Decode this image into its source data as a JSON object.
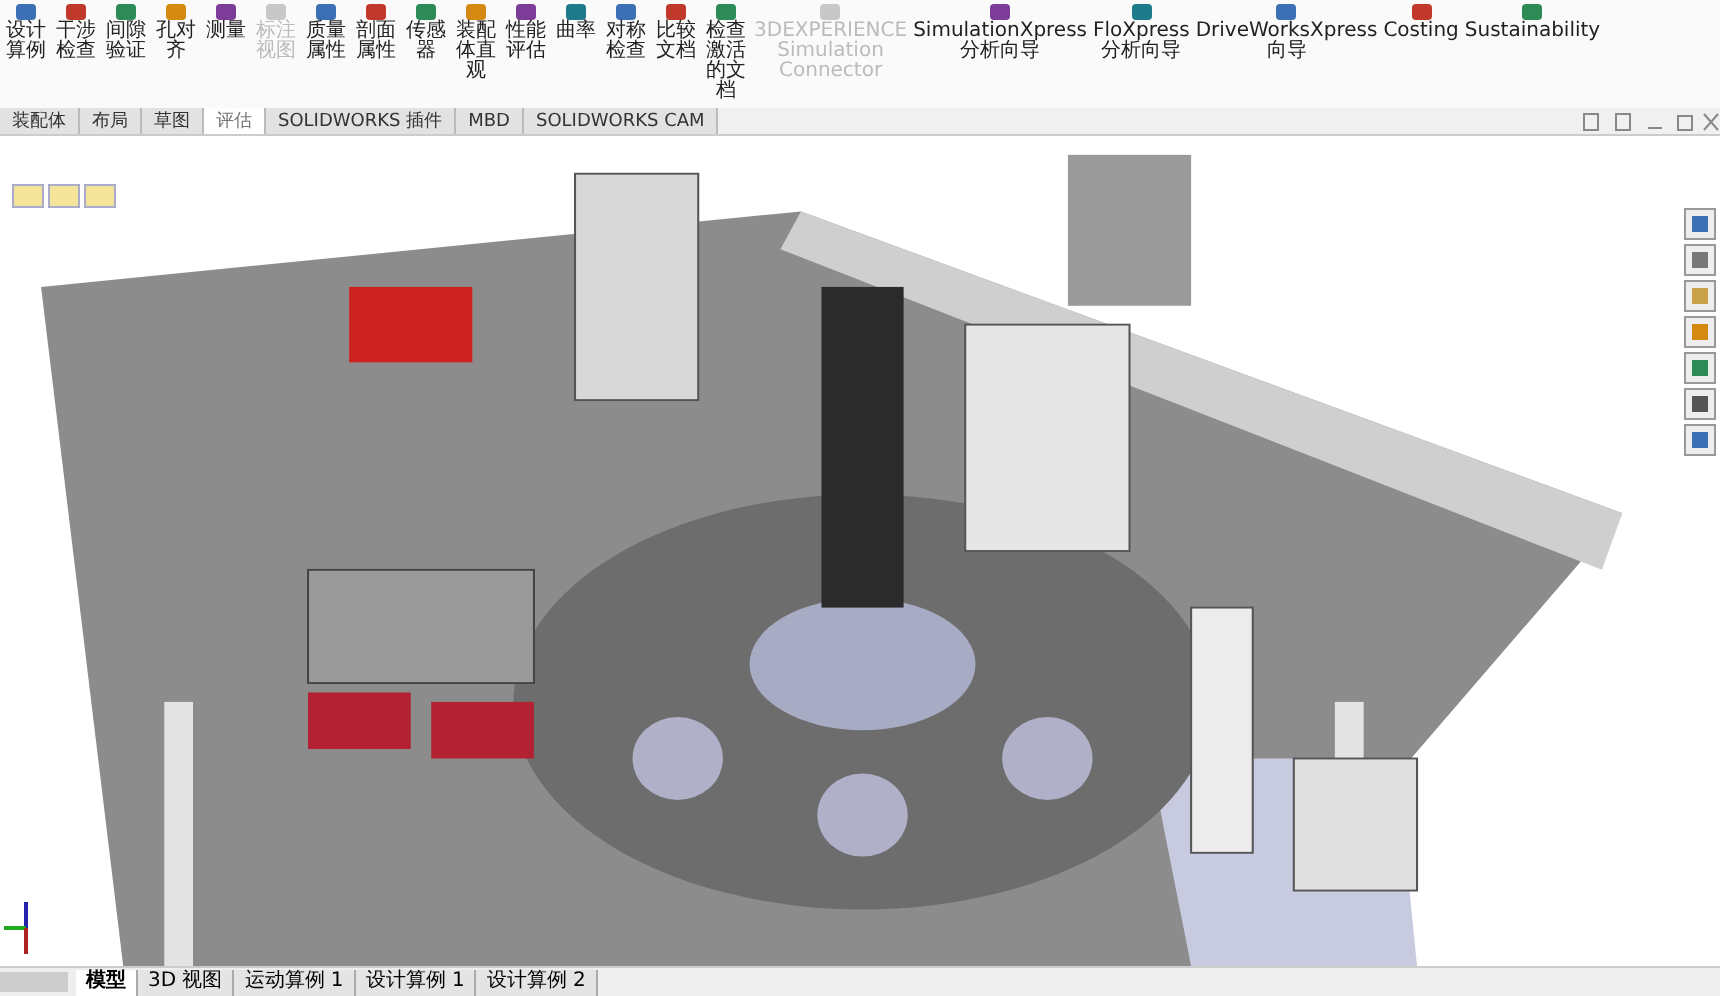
{
  "ribbon": {
    "buttons": [
      {
        "label": "设计算例",
        "disabled": false
      },
      {
        "label": "干涉检查",
        "disabled": false
      },
      {
        "label": "间隙验证",
        "disabled": false
      },
      {
        "label": "孔对齐",
        "disabled": false
      },
      {
        "label": "测量",
        "disabled": false
      },
      {
        "label": "标注视图",
        "disabled": true
      },
      {
        "label": "质量属性",
        "disabled": false
      },
      {
        "label": "剖面属性",
        "disabled": false
      },
      {
        "label": "传感器",
        "disabled": false
      },
      {
        "label": "装配体直观",
        "disabled": false
      },
      {
        "label": "性能评估",
        "disabled": false
      },
      {
        "label": "曲率",
        "disabled": false
      },
      {
        "label": "对称检查",
        "disabled": false
      },
      {
        "label": "比较文档",
        "disabled": false
      },
      {
        "label": "检查激活的文档",
        "disabled": false
      },
      {
        "label": "3DEXPERIENCE Simulation Connector",
        "disabled": true
      },
      {
        "label": "SimulationXpress 分析向导",
        "disabled": false
      },
      {
        "label": "FloXpress 分析向导",
        "disabled": false
      },
      {
        "label": "DriveWorksXpress 向导",
        "disabled": false
      },
      {
        "label": "Costing",
        "disabled": false
      },
      {
        "label": "Sustainability",
        "disabled": false
      }
    ]
  },
  "tabs": [
    {
      "label": "装配体",
      "selected": false
    },
    {
      "label": "布局",
      "selected": false
    },
    {
      "label": "草图",
      "selected": false
    },
    {
      "label": "评估",
      "selected": true
    },
    {
      "label": "SOLIDWORKS 插件",
      "selected": false
    },
    {
      "label": "MBD",
      "selected": false
    },
    {
      "label": "SOLIDWORKS CAM",
      "selected": false
    }
  ],
  "bottom_tabs": [
    {
      "label": "模型",
      "selected": true
    },
    {
      "label": "3D 视图",
      "selected": false
    },
    {
      "label": "运动算例 1",
      "selected": false
    },
    {
      "label": "设计算例 1",
      "selected": false
    },
    {
      "label": "设计算例 2",
      "selected": false
    }
  ]
}
